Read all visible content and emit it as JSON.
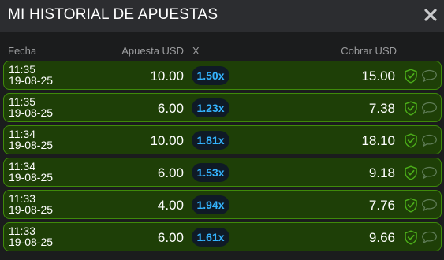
{
  "modal": {
    "title": "MI HISTORIAL DE APUESTAS",
    "close_icon": "close-icon"
  },
  "columns": {
    "fecha": "Fecha",
    "apuesta": "Apuesta USD",
    "x": "X",
    "cobrar": "Cobrar USD"
  },
  "colors": {
    "row_bg": "#1e3f07",
    "row_border": "#3f8a0a",
    "multiplier_text": "#34b4ff",
    "header_bg": "#2c2d30"
  },
  "rows": [
    {
      "time": "11:35",
      "date": "19-08-25",
      "bet": "10.00",
      "multiplier": "1.50x",
      "cashout": "15.00"
    },
    {
      "time": "11:35",
      "date": "19-08-25",
      "bet": "6.00",
      "multiplier": "1.23x",
      "cashout": "7.38"
    },
    {
      "time": "11:34",
      "date": "19-08-25",
      "bet": "10.00",
      "multiplier": "1.81x",
      "cashout": "18.10"
    },
    {
      "time": "11:34",
      "date": "19-08-25",
      "bet": "6.00",
      "multiplier": "1.53x",
      "cashout": "9.18"
    },
    {
      "time": "11:33",
      "date": "19-08-25",
      "bet": "4.00",
      "multiplier": "1.94x",
      "cashout": "7.76"
    },
    {
      "time": "11:33",
      "date": "19-08-25",
      "bet": "6.00",
      "multiplier": "1.61x",
      "cashout": "9.66"
    }
  ]
}
